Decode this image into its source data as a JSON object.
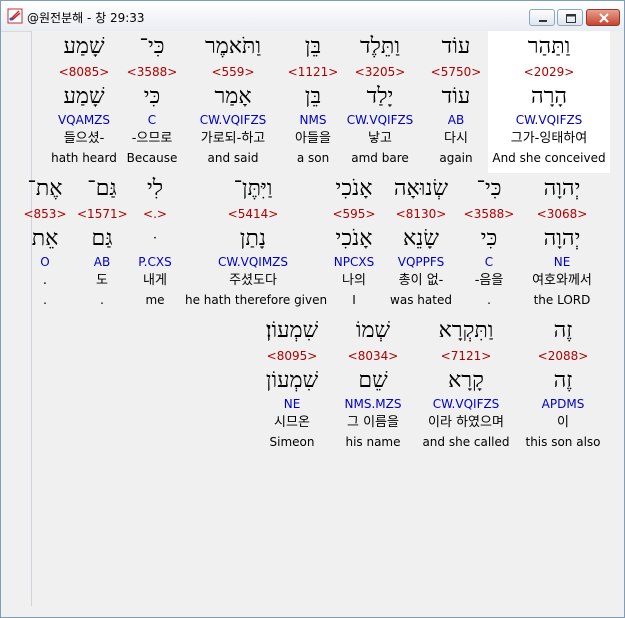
{
  "window": {
    "title": "@원전분해 - 창 29:33"
  },
  "rows": [
    {
      "words": [
        {
          "heb": "וַתַּהַר",
          "num": "<2029>",
          "root": "הָרָה",
          "code": "CW.VQIFZS",
          "kor": "그가-잉태하여",
          "eng": "And she conceived"
        },
        {
          "heb": "עוֹד",
          "num": "<5750>",
          "root": "עוֹד",
          "code": "AB",
          "kor": "다시",
          "eng": "again"
        },
        {
          "heb": "וַתֵּלֶד",
          "num": "<3205>",
          "root": "יָלַד",
          "code": "CW.VQIFZS",
          "kor": "낳고",
          "eng": "amd bare"
        },
        {
          "heb": "בֵּן",
          "num": "<1121>",
          "root": "בֵּן",
          "code": "NMS",
          "kor": "아들을",
          "eng": "a son"
        },
        {
          "heb": "וַתֹּאמֶר",
          "num": "<559>",
          "root": "אָמַר",
          "code": "CW.VQIFZS",
          "kor": "가로되-하고",
          "eng": "and said"
        },
        {
          "heb": "כִּי־",
          "num": "<3588>",
          "root": "כִּי",
          "code": "C",
          "kor": "-으므로",
          "eng": "Because"
        },
        {
          "heb": "שָׁמַע",
          "num": "<8085>",
          "root": "שָׁמַע",
          "code": "VQAMZS",
          "kor": "들으셨-",
          "eng": "hath heard"
        }
      ]
    },
    {
      "words": [
        {
          "heb": "יְהוָה",
          "num": "<3068>",
          "root": "יְהוָה",
          "code": "NE",
          "kor": "여호와께서",
          "eng": "the LORD"
        },
        {
          "heb": "כִּי־",
          "num": "<3588>",
          "root": "כִּי",
          "code": "C",
          "kor": "-음을",
          "eng": "."
        },
        {
          "heb": "שְׂנוּאָה",
          "num": "<8130>",
          "root": "שָׂנֵא",
          "code": "VQPPFS",
          "kor": "총이 없-",
          "eng": "was hated"
        },
        {
          "heb": "אָנֹכִי",
          "num": "<595>",
          "root": "אָנֹכִי",
          "code": "NPCXS",
          "kor": "나의",
          "eng": "I"
        },
        {
          "heb": "וַיִּתֶּן־",
          "num": "<5414>",
          "root": "נָתַן",
          "code": "CW.VQIMZS",
          "kor": "주셨도다",
          "eng": "he hath therefore given"
        },
        {
          "heb": "לִי",
          "num": "<.>",
          "root": "ּ",
          "code": "P.CXS",
          "kor": "내게",
          "eng": "me"
        },
        {
          "heb": "גַּם־",
          "num": "<1571>",
          "root": "גַּם",
          "code": "AB",
          "kor": "도",
          "eng": "."
        },
        {
          "heb": "אֶת־",
          "num": "<853>",
          "root": "אֵת",
          "code": "O",
          "kor": ".",
          "eng": "."
        }
      ]
    },
    {
      "words": [
        {
          "heb": "זֶה",
          "num": "<2088>",
          "root": "זֶה",
          "code": "APDMS",
          "kor": "이",
          "eng": "this son also"
        },
        {
          "heb": "וַתִּקְרָא",
          "num": "<7121>",
          "root": "קָרָא",
          "code": "CW.VQIFZS",
          "kor": "이라 하였으며",
          "eng": "and she called"
        },
        {
          "heb": "שְׁמוֹ",
          "num": "<8034>",
          "root": "שֵׁם",
          "code": "NMS.MZS",
          "kor": "그 이름을",
          "eng": "his name"
        },
        {
          "heb": "שִׁמְעוֹן׃",
          "num": "<8095>",
          "root": "שִׁמְעוֹן",
          "code": "NE",
          "kor": "시므온",
          "eng": "Simeon"
        }
      ]
    }
  ]
}
